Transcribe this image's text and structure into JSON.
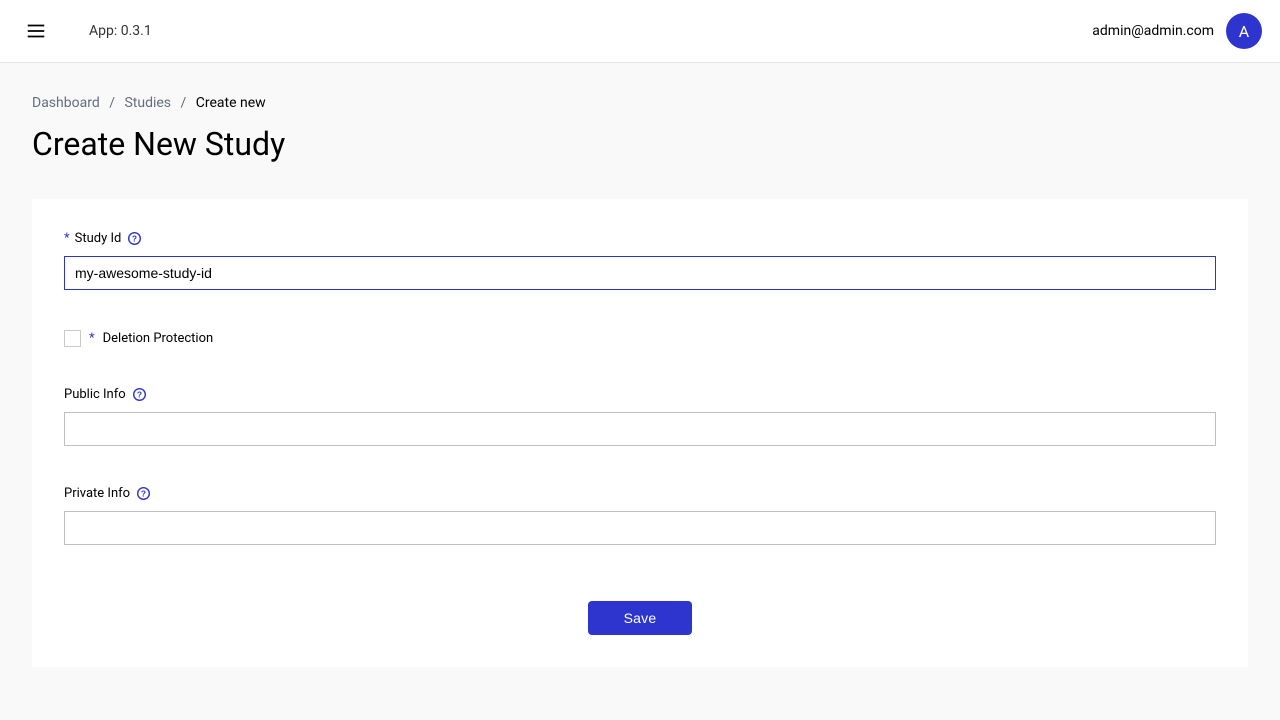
{
  "header": {
    "app_label": "App: 0.3.1",
    "user_email": "admin@admin.com",
    "avatar_initial": "A"
  },
  "breadcrumbs": {
    "items": [
      "Dashboard",
      "Studies"
    ],
    "current": "Create new"
  },
  "page": {
    "title": "Create New Study"
  },
  "form": {
    "study_id": {
      "label": "Study Id",
      "required_marker": "*",
      "value": "my-awesome-study-id"
    },
    "deletion_protection": {
      "label": "Deletion Protection",
      "required_marker": "*",
      "checked": false
    },
    "public_info": {
      "label": "Public Info",
      "value": ""
    },
    "private_info": {
      "label": "Private Info",
      "value": ""
    },
    "save_label": "Save"
  }
}
